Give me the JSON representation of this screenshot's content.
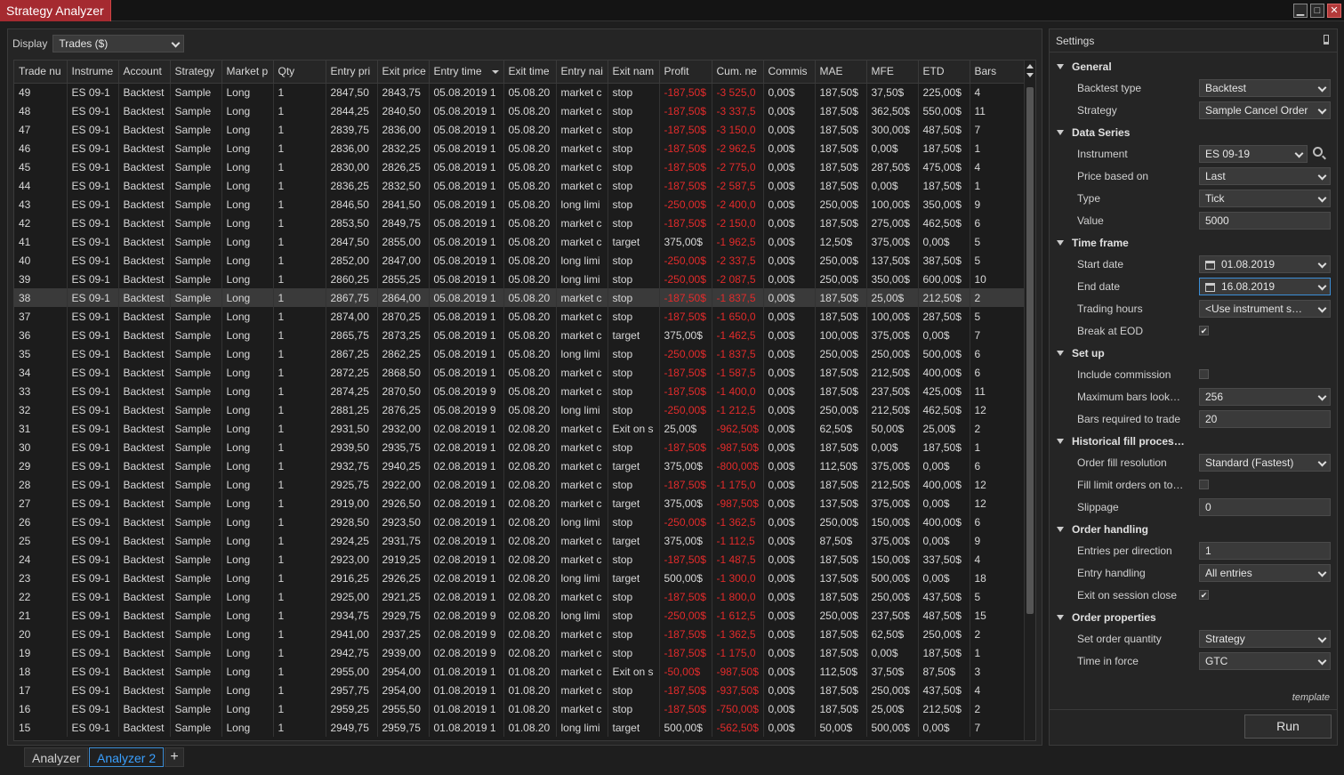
{
  "window": {
    "title": "Strategy Analyzer"
  },
  "display": {
    "label": "Display",
    "value": "Trades ($)"
  },
  "grid": {
    "columns": [
      "Trade nu",
      "Instrume",
      "Account",
      "Strategy",
      "Market p",
      "Qty",
      "Entry pri",
      "Exit price",
      "Entry time",
      "Exit time",
      "Entry nai",
      "Exit nam",
      "Profit",
      "Cum. ne",
      "Commis",
      "MAE",
      "MFE",
      "ETD",
      "Bars"
    ],
    "rows": [
      [
        "49",
        "ES 09-1",
        "Backtest",
        "Sample",
        "Long",
        "1",
        "2847,50",
        "2843,75",
        "05.08.2019 1",
        "05.08.20",
        "market c",
        "stop",
        "-187,50$",
        "-3 525,0",
        "0,00$",
        "187,50$",
        "37,50$",
        "225,00$",
        "4"
      ],
      [
        "48",
        "ES 09-1",
        "Backtest",
        "Sample",
        "Long",
        "1",
        "2844,25",
        "2840,50",
        "05.08.2019 1",
        "05.08.20",
        "market c",
        "stop",
        "-187,50$",
        "-3 337,5",
        "0,00$",
        "187,50$",
        "362,50$",
        "550,00$",
        "11"
      ],
      [
        "47",
        "ES 09-1",
        "Backtest",
        "Sample",
        "Long",
        "1",
        "2839,75",
        "2836,00",
        "05.08.2019 1",
        "05.08.20",
        "market c",
        "stop",
        "-187,50$",
        "-3 150,0",
        "0,00$",
        "187,50$",
        "300,00$",
        "487,50$",
        "7"
      ],
      [
        "46",
        "ES 09-1",
        "Backtest",
        "Sample",
        "Long",
        "1",
        "2836,00",
        "2832,25",
        "05.08.2019 1",
        "05.08.20",
        "market c",
        "stop",
        "-187,50$",
        "-2 962,5",
        "0,00$",
        "187,50$",
        "0,00$",
        "187,50$",
        "1"
      ],
      [
        "45",
        "ES 09-1",
        "Backtest",
        "Sample",
        "Long",
        "1",
        "2830,00",
        "2826,25",
        "05.08.2019 1",
        "05.08.20",
        "market c",
        "stop",
        "-187,50$",
        "-2 775,0",
        "0,00$",
        "187,50$",
        "287,50$",
        "475,00$",
        "4"
      ],
      [
        "44",
        "ES 09-1",
        "Backtest",
        "Sample",
        "Long",
        "1",
        "2836,25",
        "2832,50",
        "05.08.2019 1",
        "05.08.20",
        "market c",
        "stop",
        "-187,50$",
        "-2 587,5",
        "0,00$",
        "187,50$",
        "0,00$",
        "187,50$",
        "1"
      ],
      [
        "43",
        "ES 09-1",
        "Backtest",
        "Sample",
        "Long",
        "1",
        "2846,50",
        "2841,50",
        "05.08.2019 1",
        "05.08.20",
        "long limi",
        "stop",
        "-250,00$",
        "-2 400,0",
        "0,00$",
        "250,00$",
        "100,00$",
        "350,00$",
        "9"
      ],
      [
        "42",
        "ES 09-1",
        "Backtest",
        "Sample",
        "Long",
        "1",
        "2853,50",
        "2849,75",
        "05.08.2019 1",
        "05.08.20",
        "market c",
        "stop",
        "-187,50$",
        "-2 150,0",
        "0,00$",
        "187,50$",
        "275,00$",
        "462,50$",
        "6"
      ],
      [
        "41",
        "ES 09-1",
        "Backtest",
        "Sample",
        "Long",
        "1",
        "2847,50",
        "2855,00",
        "05.08.2019 1",
        "05.08.20",
        "market c",
        "target",
        "375,00$",
        "-1 962,5",
        "0,00$",
        "12,50$",
        "375,00$",
        "0,00$",
        "5"
      ],
      [
        "40",
        "ES 09-1",
        "Backtest",
        "Sample",
        "Long",
        "1",
        "2852,00",
        "2847,00",
        "05.08.2019 1",
        "05.08.20",
        "long limi",
        "stop",
        "-250,00$",
        "-2 337,5",
        "0,00$",
        "250,00$",
        "137,50$",
        "387,50$",
        "5"
      ],
      [
        "39",
        "ES 09-1",
        "Backtest",
        "Sample",
        "Long",
        "1",
        "2860,25",
        "2855,25",
        "05.08.2019 1",
        "05.08.20",
        "long limi",
        "stop",
        "-250,00$",
        "-2 087,5",
        "0,00$",
        "250,00$",
        "350,00$",
        "600,00$",
        "10"
      ],
      [
        "38",
        "ES 09-1",
        "Backtest",
        "Sample",
        "Long",
        "1",
        "2867,75",
        "2864,00",
        "05.08.2019 1",
        "05.08.20",
        "market c",
        "stop",
        "-187,50$",
        "-1 837,5",
        "0,00$",
        "187,50$",
        "25,00$",
        "212,50$",
        "2"
      ],
      [
        "37",
        "ES 09-1",
        "Backtest",
        "Sample",
        "Long",
        "1",
        "2874,00",
        "2870,25",
        "05.08.2019 1",
        "05.08.20",
        "market c",
        "stop",
        "-187,50$",
        "-1 650,0",
        "0,00$",
        "187,50$",
        "100,00$",
        "287,50$",
        "5"
      ],
      [
        "36",
        "ES 09-1",
        "Backtest",
        "Sample",
        "Long",
        "1",
        "2865,75",
        "2873,25",
        "05.08.2019 1",
        "05.08.20",
        "market c",
        "target",
        "375,00$",
        "-1 462,5",
        "0,00$",
        "100,00$",
        "375,00$",
        "0,00$",
        "7"
      ],
      [
        "35",
        "ES 09-1",
        "Backtest",
        "Sample",
        "Long",
        "1",
        "2867,25",
        "2862,25",
        "05.08.2019 1",
        "05.08.20",
        "long limi",
        "stop",
        "-250,00$",
        "-1 837,5",
        "0,00$",
        "250,00$",
        "250,00$",
        "500,00$",
        "6"
      ],
      [
        "34",
        "ES 09-1",
        "Backtest",
        "Sample",
        "Long",
        "1",
        "2872,25",
        "2868,50",
        "05.08.2019 1",
        "05.08.20",
        "market c",
        "stop",
        "-187,50$",
        "-1 587,5",
        "0,00$",
        "187,50$",
        "212,50$",
        "400,00$",
        "6"
      ],
      [
        "33",
        "ES 09-1",
        "Backtest",
        "Sample",
        "Long",
        "1",
        "2874,25",
        "2870,50",
        "05.08.2019 9",
        "05.08.20",
        "market c",
        "stop",
        "-187,50$",
        "-1 400,0",
        "0,00$",
        "187,50$",
        "237,50$",
        "425,00$",
        "11"
      ],
      [
        "32",
        "ES 09-1",
        "Backtest",
        "Sample",
        "Long",
        "1",
        "2881,25",
        "2876,25",
        "05.08.2019 9",
        "05.08.20",
        "long limi",
        "stop",
        "-250,00$",
        "-1 212,5",
        "0,00$",
        "250,00$",
        "212,50$",
        "462,50$",
        "12"
      ],
      [
        "31",
        "ES 09-1",
        "Backtest",
        "Sample",
        "Long",
        "1",
        "2931,50",
        "2932,00",
        "02.08.2019 1",
        "02.08.20",
        "market c",
        "Exit on s",
        "25,00$",
        "-962,50$",
        "0,00$",
        "62,50$",
        "50,00$",
        "25,00$",
        "2"
      ],
      [
        "30",
        "ES 09-1",
        "Backtest",
        "Sample",
        "Long",
        "1",
        "2939,50",
        "2935,75",
        "02.08.2019 1",
        "02.08.20",
        "market c",
        "stop",
        "-187,50$",
        "-987,50$",
        "0,00$",
        "187,50$",
        "0,00$",
        "187,50$",
        "1"
      ],
      [
        "29",
        "ES 09-1",
        "Backtest",
        "Sample",
        "Long",
        "1",
        "2932,75",
        "2940,25",
        "02.08.2019 1",
        "02.08.20",
        "market c",
        "target",
        "375,00$",
        "-800,00$",
        "0,00$",
        "112,50$",
        "375,00$",
        "0,00$",
        "6"
      ],
      [
        "28",
        "ES 09-1",
        "Backtest",
        "Sample",
        "Long",
        "1",
        "2925,75",
        "2922,00",
        "02.08.2019 1",
        "02.08.20",
        "market c",
        "stop",
        "-187,50$",
        "-1 175,0",
        "0,00$",
        "187,50$",
        "212,50$",
        "400,00$",
        "12"
      ],
      [
        "27",
        "ES 09-1",
        "Backtest",
        "Sample",
        "Long",
        "1",
        "2919,00",
        "2926,50",
        "02.08.2019 1",
        "02.08.20",
        "market c",
        "target",
        "375,00$",
        "-987,50$",
        "0,00$",
        "137,50$",
        "375,00$",
        "0,00$",
        "12"
      ],
      [
        "26",
        "ES 09-1",
        "Backtest",
        "Sample",
        "Long",
        "1",
        "2928,50",
        "2923,50",
        "02.08.2019 1",
        "02.08.20",
        "long limi",
        "stop",
        "-250,00$",
        "-1 362,5",
        "0,00$",
        "250,00$",
        "150,00$",
        "400,00$",
        "6"
      ],
      [
        "25",
        "ES 09-1",
        "Backtest",
        "Sample",
        "Long",
        "1",
        "2924,25",
        "2931,75",
        "02.08.2019 1",
        "02.08.20",
        "market c",
        "target",
        "375,00$",
        "-1 112,5",
        "0,00$",
        "87,50$",
        "375,00$",
        "0,00$",
        "9"
      ],
      [
        "24",
        "ES 09-1",
        "Backtest",
        "Sample",
        "Long",
        "1",
        "2923,00",
        "2919,25",
        "02.08.2019 1",
        "02.08.20",
        "market c",
        "stop",
        "-187,50$",
        "-1 487,5",
        "0,00$",
        "187,50$",
        "150,00$",
        "337,50$",
        "4"
      ],
      [
        "23",
        "ES 09-1",
        "Backtest",
        "Sample",
        "Long",
        "1",
        "2916,25",
        "2926,25",
        "02.08.2019 1",
        "02.08.20",
        "long limi",
        "target",
        "500,00$",
        "-1 300,0",
        "0,00$",
        "137,50$",
        "500,00$",
        "0,00$",
        "18"
      ],
      [
        "22",
        "ES 09-1",
        "Backtest",
        "Sample",
        "Long",
        "1",
        "2925,00",
        "2921,25",
        "02.08.2019 1",
        "02.08.20",
        "market c",
        "stop",
        "-187,50$",
        "-1 800,0",
        "0,00$",
        "187,50$",
        "250,00$",
        "437,50$",
        "5"
      ],
      [
        "21",
        "ES 09-1",
        "Backtest",
        "Sample",
        "Long",
        "1",
        "2934,75",
        "2929,75",
        "02.08.2019 9",
        "02.08.20",
        "long limi",
        "stop",
        "-250,00$",
        "-1 612,5",
        "0,00$",
        "250,00$",
        "237,50$",
        "487,50$",
        "15"
      ],
      [
        "20",
        "ES 09-1",
        "Backtest",
        "Sample",
        "Long",
        "1",
        "2941,00",
        "2937,25",
        "02.08.2019 9",
        "02.08.20",
        "market c",
        "stop",
        "-187,50$",
        "-1 362,5",
        "0,00$",
        "187,50$",
        "62,50$",
        "250,00$",
        "2"
      ],
      [
        "19",
        "ES 09-1",
        "Backtest",
        "Sample",
        "Long",
        "1",
        "2942,75",
        "2939,00",
        "02.08.2019 9",
        "02.08.20",
        "market c",
        "stop",
        "-187,50$",
        "-1 175,0",
        "0,00$",
        "187,50$",
        "0,00$",
        "187,50$",
        "1"
      ],
      [
        "18",
        "ES 09-1",
        "Backtest",
        "Sample",
        "Long",
        "1",
        "2955,00",
        "2954,00",
        "01.08.2019 1",
        "01.08.20",
        "market c",
        "Exit on s",
        "-50,00$",
        "-987,50$",
        "0,00$",
        "112,50$",
        "37,50$",
        "87,50$",
        "3"
      ],
      [
        "17",
        "ES 09-1",
        "Backtest",
        "Sample",
        "Long",
        "1",
        "2957,75",
        "2954,00",
        "01.08.2019 1",
        "01.08.20",
        "market c",
        "stop",
        "-187,50$",
        "-937,50$",
        "0,00$",
        "187,50$",
        "250,00$",
        "437,50$",
        "4"
      ],
      [
        "16",
        "ES 09-1",
        "Backtest",
        "Sample",
        "Long",
        "1",
        "2959,25",
        "2955,50",
        "01.08.2019 1",
        "01.08.20",
        "market c",
        "stop",
        "-187,50$",
        "-750,00$",
        "0,00$",
        "187,50$",
        "25,00$",
        "212,50$",
        "2"
      ],
      [
        "15",
        "ES 09-1",
        "Backtest",
        "Sample",
        "Long",
        "1",
        "2949,75",
        "2959,75",
        "01.08.2019 1",
        "01.08.20",
        "long limi",
        "target",
        "500,00$",
        "-562,50$",
        "0,00$",
        "50,00$",
        "500,00$",
        "0,00$",
        "7"
      ]
    ],
    "selected_trade": "38"
  },
  "settings": {
    "header": "Settings",
    "groups": [
      {
        "title": "General",
        "props": [
          {
            "label": "Backtest type",
            "kind": "select",
            "value": "Backtest"
          },
          {
            "label": "Strategy",
            "kind": "select",
            "value": "Sample Cancel Order"
          }
        ]
      },
      {
        "title": "Data Series",
        "props": [
          {
            "label": "Instrument",
            "kind": "instrument",
            "value": "ES 09-19"
          },
          {
            "label": "Price based on",
            "kind": "select",
            "value": "Last"
          },
          {
            "label": "Type",
            "kind": "select",
            "value": "Tick"
          },
          {
            "label": "Value",
            "kind": "text",
            "value": "5000"
          }
        ]
      },
      {
        "title": "Time frame",
        "props": [
          {
            "label": "Start date",
            "kind": "date",
            "value": "01.08.2019"
          },
          {
            "label": "End date",
            "kind": "date",
            "value": "16.08.2019",
            "focused": true
          },
          {
            "label": "Trading hours",
            "kind": "select",
            "value": "<Use instrument s…"
          },
          {
            "label": "Break at EOD",
            "kind": "check",
            "value": true
          }
        ]
      },
      {
        "title": "Set up",
        "props": [
          {
            "label": "Include commission",
            "kind": "check",
            "value": false
          },
          {
            "label": "Maximum bars look…",
            "kind": "select",
            "value": "256"
          },
          {
            "label": "Bars required to trade",
            "kind": "text",
            "value": "20"
          }
        ]
      },
      {
        "title": "Historical fill proces…",
        "props": [
          {
            "label": "Order fill resolution",
            "kind": "select",
            "value": "Standard (Fastest)"
          },
          {
            "label": "Fill limit orders on to…",
            "kind": "check",
            "value": false
          },
          {
            "label": "Slippage",
            "kind": "text",
            "value": "0"
          }
        ]
      },
      {
        "title": "Order handling",
        "props": [
          {
            "label": "Entries per direction",
            "kind": "text",
            "value": "1"
          },
          {
            "label": "Entry handling",
            "kind": "select",
            "value": "All entries"
          },
          {
            "label": "Exit on session close",
            "kind": "check",
            "value": true
          }
        ]
      },
      {
        "title": "Order properties",
        "props": [
          {
            "label": "Set order quantity",
            "kind": "select",
            "value": "Strategy"
          },
          {
            "label": "Time in force",
            "kind": "select",
            "value": "GTC"
          }
        ]
      }
    ],
    "template_label": "template",
    "run_label": "Run"
  },
  "tabs": {
    "items": [
      "Analyzer",
      "Analyzer 2"
    ],
    "active": 1,
    "add_label": "+"
  },
  "colors": {
    "accent": "#3c8ed6",
    "negative": "#e32b2b",
    "title_bg": "#a52a30"
  }
}
